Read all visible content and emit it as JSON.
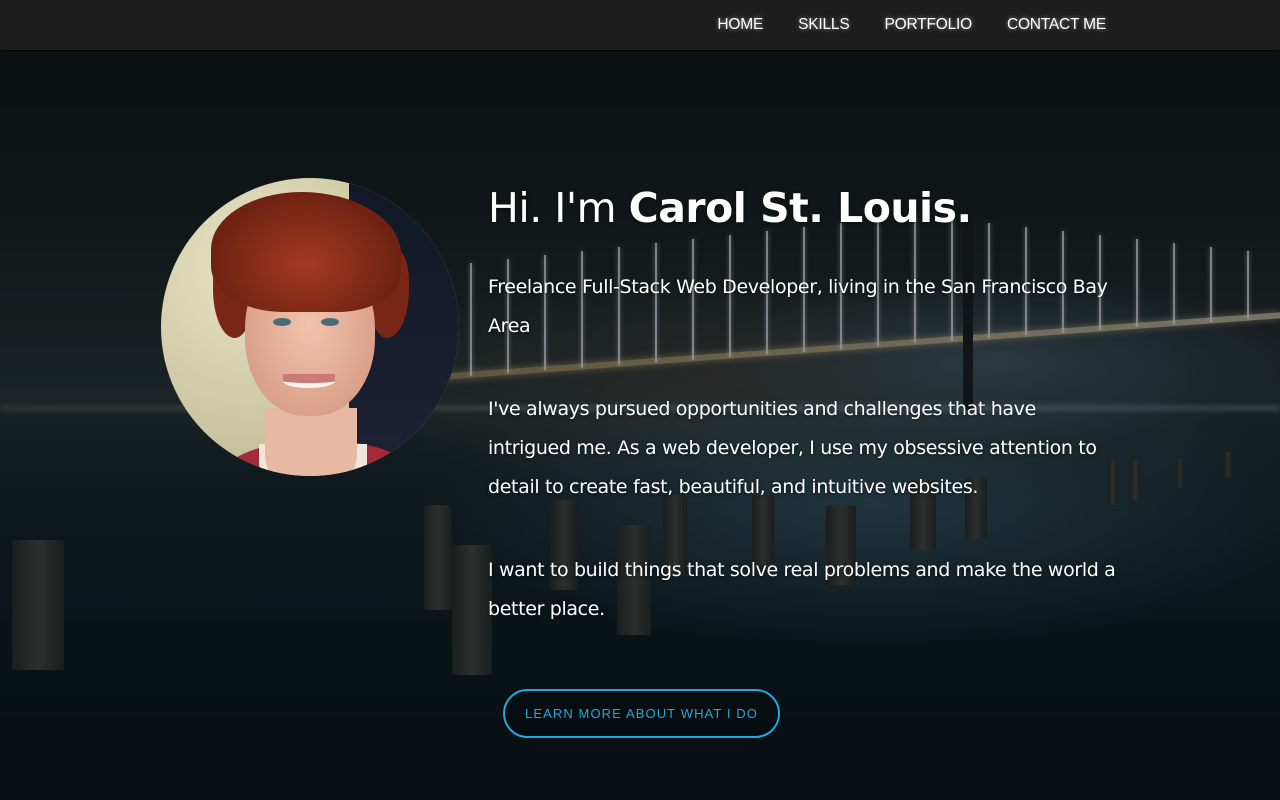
{
  "nav": {
    "items": [
      {
        "label": "HOME"
      },
      {
        "label": "SKILLS"
      },
      {
        "label": "PORTFOLIO"
      },
      {
        "label": "CONTACT ME"
      }
    ]
  },
  "hero": {
    "greeting": "Hi. I'm ",
    "name": "Carol  St. Louis.",
    "paragraphs": [
      "Freelance Full-Stack Web Developer, living in the San Francisco Bay Area",
      "I've always pursued opportunities and challenges that have intrigued me. As a web developer, I use my obsessive attention to detail to create fast, beautiful, and intuitive websites.",
      "I want to build things that solve real problems and make the world a better place."
    ],
    "cta_label": "LEARN MORE ABOUT WHAT I DO"
  },
  "colors": {
    "accent": "#1fa9dc",
    "navbar_bg": "#1d1d1d",
    "text": "#ffffff"
  }
}
